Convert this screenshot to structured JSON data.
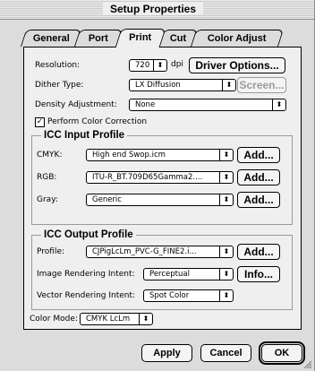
{
  "window": {
    "title": "Setup Properties"
  },
  "tabs": [
    {
      "label": "General"
    },
    {
      "label": "Port"
    },
    {
      "label": "Print",
      "active": true
    },
    {
      "label": "Cut"
    },
    {
      "label": "Color Adjust"
    }
  ],
  "print": {
    "resolution_label": "Resolution:",
    "resolution_value": "720",
    "resolution_unit": "dpi",
    "driver_options_button": "Driver Options...",
    "dither_label": "Dither Type:",
    "dither_value": "LX Diffusion",
    "screen_button": "Screen...",
    "density_label": "Density Adjustment:",
    "density_value": "None",
    "color_correction_label": "Perform Color Correction",
    "color_correction_checked": true,
    "icc_input": {
      "title": "ICC Input Profile",
      "cmyk_label": "CMYK:",
      "cmyk_value": "High end Swop.icm",
      "rgb_label": "RGB:",
      "rgb_value": "ITU-R_BT.709D65Gamma2....",
      "gray_label": "Gray:",
      "gray_value": "Generic",
      "add_label": "Add..."
    },
    "icc_output": {
      "title": "ICC Output Profile",
      "profile_label": "Profile:",
      "profile_value": "CJPigLcLm_PVC-G_FINE2.i...",
      "add_label": "Add...",
      "image_intent_label": "Image Rendering Intent:",
      "image_intent_value": "Perceptual",
      "info_label": "Info...",
      "vector_intent_label": "Vector Rendering Intent:",
      "vector_intent_value": "Spot Color"
    },
    "color_mode_label": "Color Mode:",
    "color_mode_value": "CMYK LcLm"
  },
  "footer": {
    "apply": "Apply",
    "cancel": "Cancel",
    "ok": "OK"
  },
  "icons": {
    "popup_arrows": "⬍",
    "checkmark": "✓"
  }
}
